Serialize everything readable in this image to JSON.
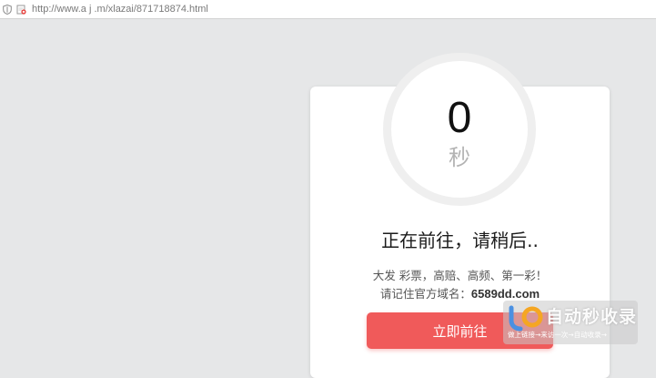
{
  "browser": {
    "url": "http://www.a  j  .m/xlazai/871718874.html",
    "icons": [
      "shield-icon",
      "broken-page-icon"
    ]
  },
  "countdown": {
    "value": "0",
    "unit": "秒"
  },
  "card": {
    "heading": "正在前往，请稍后..",
    "line1": "大发 彩票，高赔、高频、第一彩！",
    "line2_prefix": "请记住官方域名：",
    "domain": "6589dd.com",
    "button_label": "立即前往",
    "accent_color": "#f05a5a"
  },
  "watermark": {
    "title": "自动秒收录",
    "subtitle": "做上链接→来访一次→自动收录→"
  }
}
